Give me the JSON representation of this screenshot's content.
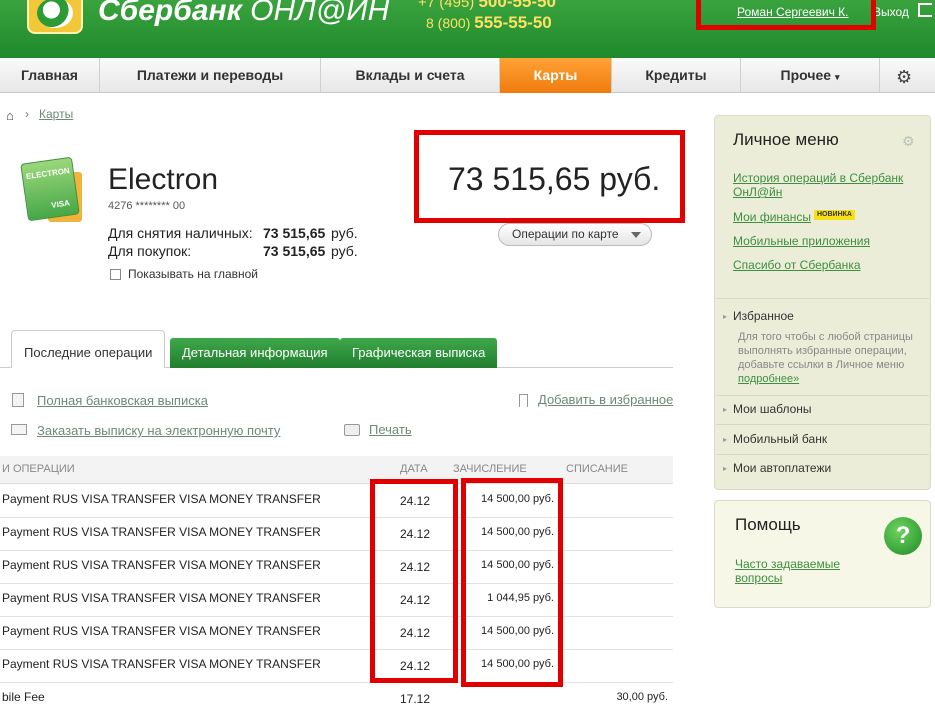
{
  "header": {
    "brand_bold": "Сбербанк",
    "brand_light": " ОНЛ@ЙН",
    "phone1_prefix": "+7 (495) ",
    "phone1_number": "500-55-50",
    "phone2_prefix": "8 (800) ",
    "phone2_number": "555-55-50",
    "user_name": "Роман Сергеевич К.",
    "exit_label": "Выход"
  },
  "nav": {
    "items": [
      "Главная",
      "Платежи и переводы",
      "Вклады и счета",
      "Карты",
      "Кредиты",
      "Прочее"
    ],
    "active": "Карты"
  },
  "breadcrumb": {
    "current": "Карты"
  },
  "card": {
    "title": "Electron",
    "number": "4276 ******** 00",
    "logo_top": "ELECTRON",
    "logo_brand": "VISA",
    "cash_label": "Для снятия наличных:",
    "cash_value": "73 515,65",
    "purchase_label": "Для покупок:",
    "purchase_value": "73 515,65",
    "currency": "руб.",
    "show_on_main": "Показывать на главной",
    "balance": "73 515,65 руб.",
    "ops_button": "Операции по карте"
  },
  "tabs": [
    "Последние операции",
    "Детальная информация",
    "Графическая выписка"
  ],
  "links": {
    "full_statement": "Полная банковская выписка",
    "email_statement": "Заказать выписку на электронную почту",
    "print": "Печать",
    "add_favorite": "Добавить в избранное"
  },
  "table": {
    "headers": [
      "и операции",
      "Дата",
      "Зачисление",
      "Списание"
    ],
    "rows": [
      {
        "desc": "Payment RUS VISA TRANSFER VISA MONEY TRANSFER",
        "date": "24.12",
        "credit": "14 500,00 руб.",
        "debit": ""
      },
      {
        "desc": "Payment RUS VISA TRANSFER VISA MONEY TRANSFER",
        "date": "24.12",
        "credit": "14 500,00 руб.",
        "debit": ""
      },
      {
        "desc": "Payment RUS VISA TRANSFER VISA MONEY TRANSFER",
        "date": "24.12",
        "credit": "14 500,00 руб.",
        "debit": ""
      },
      {
        "desc": "Payment RUS VISA TRANSFER VISA MONEY TRANSFER",
        "date": "24.12",
        "credit": "1 044,95 руб.",
        "debit": ""
      },
      {
        "desc": "Payment RUS VISA TRANSFER VISA MONEY TRANSFER",
        "date": "24.12",
        "credit": "14 500,00 руб.",
        "debit": ""
      },
      {
        "desc": "Payment RUS VISA TRANSFER VISA MONEY TRANSFER",
        "date": "24.12",
        "credit": "14 500,00 руб.",
        "debit": ""
      },
      {
        "desc": "bile Fee",
        "date": "17.12",
        "credit": "",
        "debit": "30,00 руб."
      }
    ]
  },
  "sidebar": {
    "title": "Личное меню",
    "links": [
      "История операций в Сбербанк ОнЛ@йн",
      "Мои финансы",
      "Мобильные приложения",
      "Спасибо от Сбербанка"
    ],
    "new_badge": "НОВИНКА",
    "favorites_title": "Избранное",
    "favorites_desc": "Для того чтобы с любой страницы выполнять избранные операции, добавьте ссылки в Личное меню ",
    "favorites_more": "подробнее»",
    "items": [
      "Мои шаблоны",
      "Мобильный банк",
      "Мои автоплатежи"
    ]
  },
  "help": {
    "title": "Помощь",
    "link": "Часто задаваемые вопросы",
    "icon_glyph": "?"
  },
  "colors": {
    "header_green": "#1f8a2c",
    "active_tab_orange": "#f07b0f",
    "highlight_red": "#e00000",
    "link_green": "#3d8f3f"
  }
}
